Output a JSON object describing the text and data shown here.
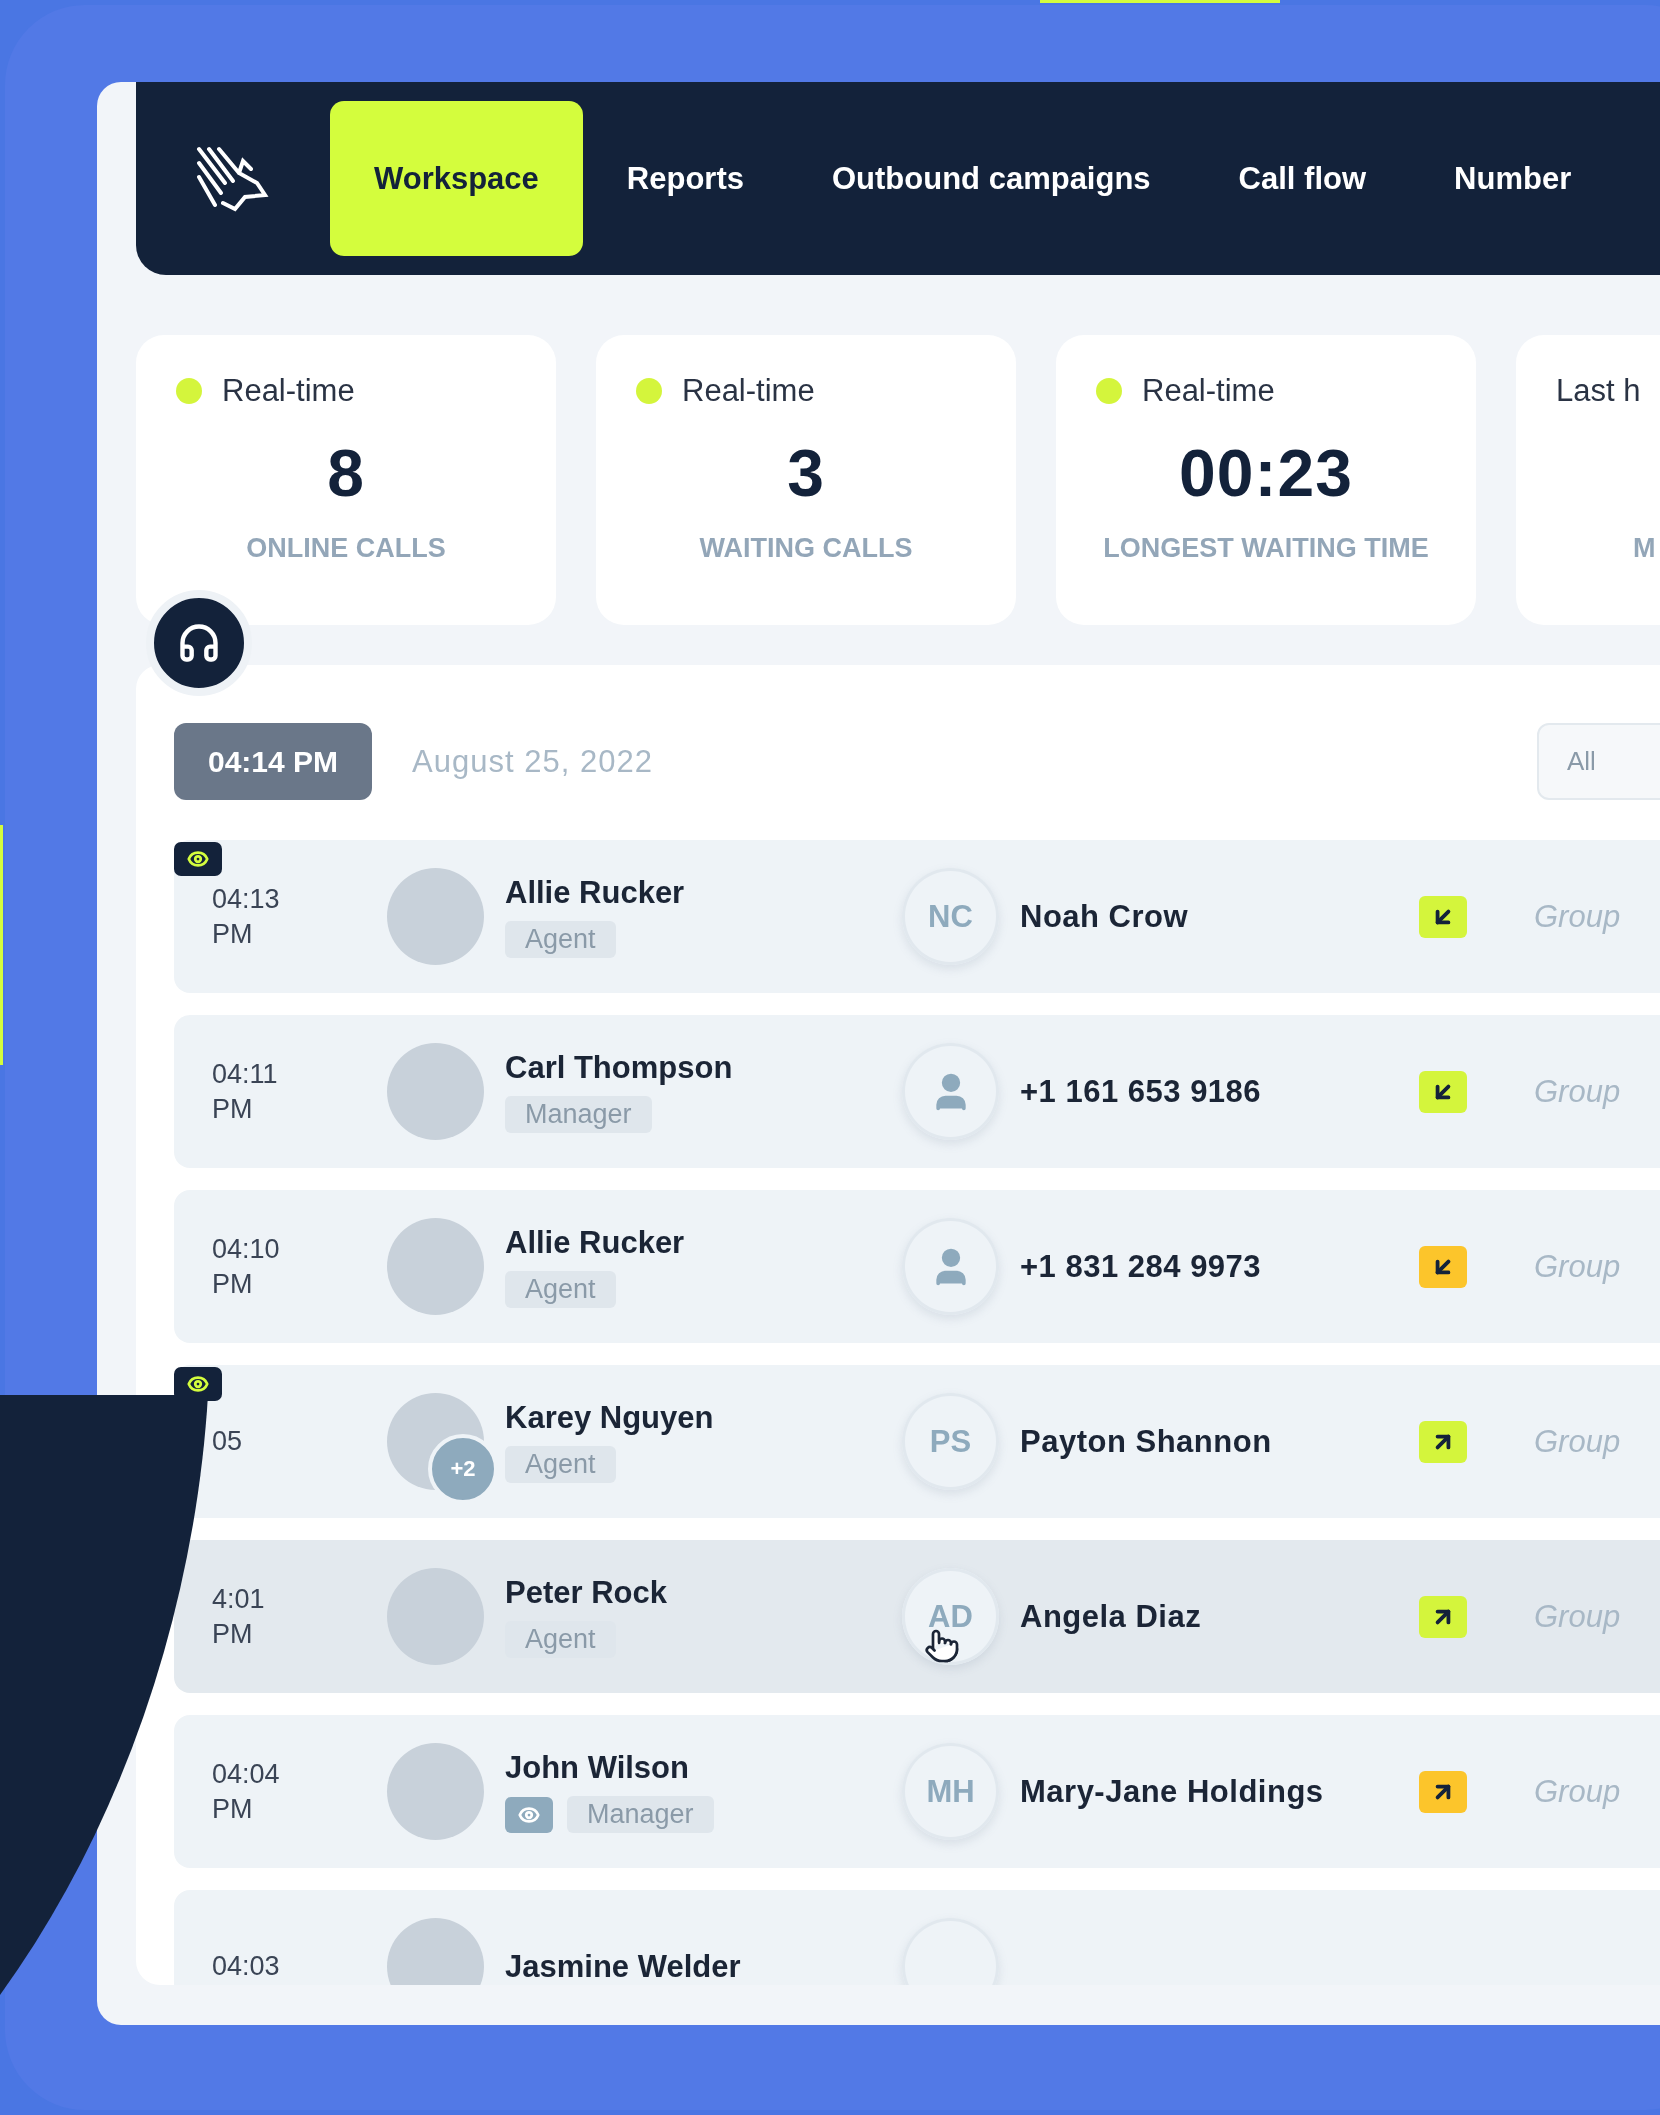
{
  "nav": {
    "tabs": [
      {
        "label": "Workspace",
        "selected": true
      },
      {
        "label": "Reports",
        "selected": false
      },
      {
        "label": "Outbound campaigns",
        "selected": false
      },
      {
        "label": "Call flow",
        "selected": false
      },
      {
        "label": "Number",
        "selected": false
      }
    ]
  },
  "stats": [
    {
      "period": "Real-time",
      "live": true,
      "value": "8",
      "label": "ONLINE CALLS"
    },
    {
      "period": "Real-time",
      "live": true,
      "value": "3",
      "label": "WAITING CALLS"
    },
    {
      "period": "Real-time",
      "live": true,
      "value": "00:23",
      "label": "LONGEST WAITING TIME"
    },
    {
      "period": "Last h",
      "live": false,
      "label": "M"
    }
  ],
  "clock": {
    "time": "04:14 PM",
    "date": "August 25, 2022"
  },
  "filter": {
    "value": "All"
  },
  "calls": [
    {
      "time": [
        "04:13",
        "PM"
      ],
      "monitored": true,
      "hovered": false,
      "agent": {
        "name": "Allie Rucker",
        "role": "Agent",
        "listening": false
      },
      "contact": {
        "kind": "initials",
        "initials": "NC",
        "name": "Noah Crow"
      },
      "kind": "incoming",
      "color": "#d4f53c",
      "group": "Group"
    },
    {
      "time": [
        "04:11",
        "PM"
      ],
      "monitored": false,
      "hovered": false,
      "agent": {
        "name": "Carl Thompson",
        "role": "Manager",
        "listening": false
      },
      "contact": {
        "kind": "unknown",
        "name": "+1 161 653 9186"
      },
      "kind": "incoming",
      "color": "#d4f53c",
      "group": "Group"
    },
    {
      "time": [
        "04:10",
        "PM"
      ],
      "monitored": false,
      "hovered": false,
      "agent": {
        "name": "Allie Rucker",
        "role": "Agent",
        "listening": false
      },
      "contact": {
        "kind": "unknown",
        "name": "+1 831 284 9973"
      },
      "kind": "incoming",
      "color": "#fcc52b",
      "group": "Group"
    },
    {
      "time": [
        "05"
      ],
      "monitored": true,
      "hovered": false,
      "agent": {
        "name": "Karey Nguyen",
        "role": "Agent",
        "listening": false,
        "extra": "+2"
      },
      "contact": {
        "kind": "initials",
        "initials": "PS",
        "name": "Payton Shannon"
      },
      "kind": "outgoing",
      "color": "#d4f53c",
      "group": "Group"
    },
    {
      "time": [
        "4:01",
        "PM"
      ],
      "monitored": false,
      "hovered": true,
      "agent": {
        "name": "Peter Rock",
        "role": "Agent",
        "listening": false
      },
      "contact": {
        "kind": "initials",
        "initials": "AD",
        "name": "Angela Diaz"
      },
      "kind": "outgoing",
      "color": "#d4f53c",
      "group": "Group"
    },
    {
      "time": [
        "04:04",
        "PM"
      ],
      "monitored": false,
      "hovered": false,
      "agent": {
        "name": "John Wilson",
        "role": "Manager",
        "listening": true
      },
      "contact": {
        "kind": "initials",
        "initials": "MH",
        "name": "Mary-Jane Holdings"
      },
      "kind": "outgoing",
      "color": "#fcc52b",
      "group": "Group"
    },
    {
      "time": [
        "04:03"
      ],
      "monitored": false,
      "hovered": false,
      "agent": {
        "name": "Jasmine Welder",
        "listening": false
      },
      "contact": {
        "kind": "blank"
      }
    }
  ]
}
